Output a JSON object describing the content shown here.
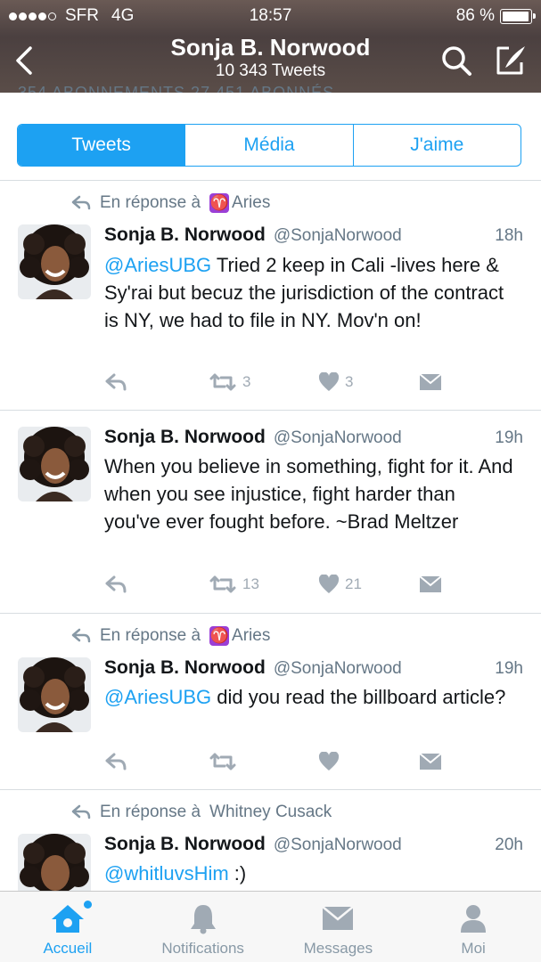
{
  "status": {
    "carrier": "SFR",
    "network": "4G",
    "time": "18:57",
    "battery": "86 %"
  },
  "profile_nav": {
    "title": "Sonja B. Norwood",
    "subtitle": "10 343 Tweets"
  },
  "peek_text": "354 ABONNEMENTS   27 451 ABONNÉS",
  "segments": [
    {
      "label": "Tweets",
      "active": true
    },
    {
      "label": "Média",
      "active": false
    },
    {
      "label": "J'aime",
      "active": false
    }
  ],
  "tweets": [
    {
      "reply_prefix": "En réponse à",
      "reply_to": "Aries",
      "reply_badge": "♈",
      "name": "Sonja B. Norwood",
      "handle": "@SonjaNorwood",
      "time": "18h",
      "mention": "@AriesUBG",
      "text": " Tried 2 keep in Cali -lives here & Sy'rai but becuz the jurisdiction of the contract is NY, we had to file in NY. Mov'n on!",
      "retweets": "3",
      "likes": "3"
    },
    {
      "name": "Sonja B. Norwood",
      "handle": "@SonjaNorwood",
      "time": "19h",
      "text": "When you believe in something, fight for it. And when you see injustice, fight harder than you've ever fought before. ~Brad Meltzer",
      "retweets": "13",
      "likes": "21"
    },
    {
      "reply_prefix": "En réponse à",
      "reply_to": "Aries",
      "reply_badge": "♈",
      "name": "Sonja B. Norwood",
      "handle": "@SonjaNorwood",
      "time": "19h",
      "mention": "@AriesUBG",
      "text": " did you read the billboard article?",
      "retweets": "",
      "likes": ""
    },
    {
      "reply_prefix": "En réponse à",
      "reply_to": "Whitney Cusack",
      "name": "Sonja B. Norwood",
      "handle": "@SonjaNorwood",
      "time": "20h",
      "mention": "@whitluvsHim",
      "text": " :)"
    }
  ],
  "tabbar": [
    {
      "label": "Accueil",
      "icon": "home-icon",
      "active": true
    },
    {
      "label": "Notifications",
      "icon": "bell-icon",
      "active": false
    },
    {
      "label": "Messages",
      "icon": "envelope-icon",
      "active": false
    },
    {
      "label": "Moi",
      "icon": "person-icon",
      "active": false
    }
  ],
  "colors": {
    "accent": "#1da1f2",
    "muted": "#657786",
    "badge": "#9b3fd6"
  }
}
